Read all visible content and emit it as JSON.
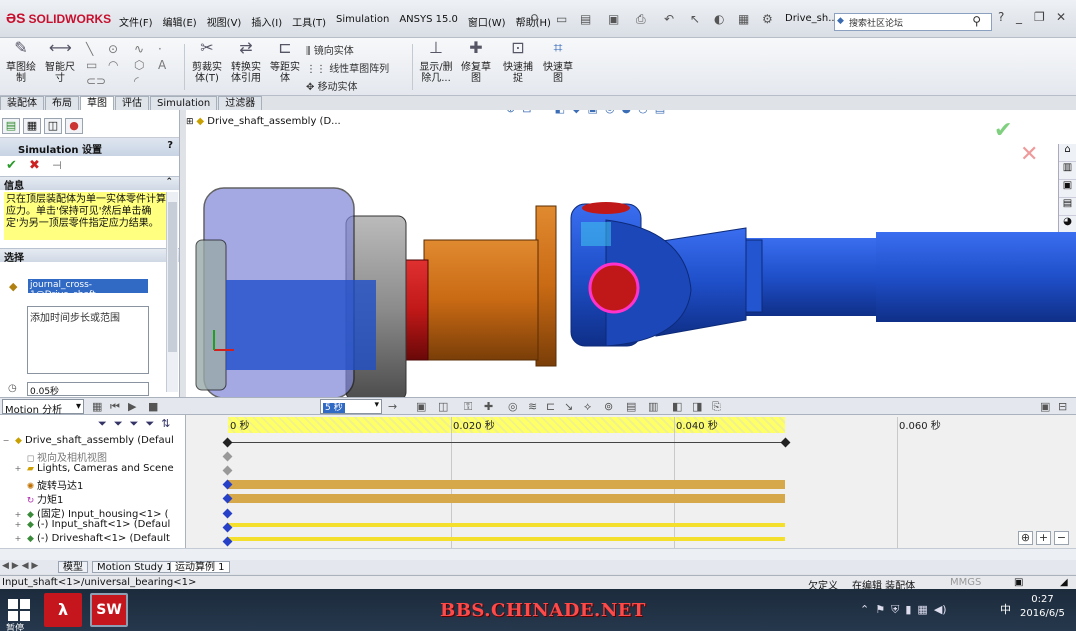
{
  "app": {
    "logo_text": "SOLIDWORKS",
    "document_title": "Drive_sh...",
    "search_placeholder": "搜索社区论坛"
  },
  "menu": [
    "文件(F)",
    "编辑(E)",
    "视图(V)",
    "插入(I)",
    "工具(T)",
    "Simulation",
    "ANSYS 15.0",
    "窗口(W)",
    "帮助(H)"
  ],
  "ribbon": {
    "sketch": "草图绘\n制",
    "smart_dim": "智能尺\n寸",
    "trim": "剪裁实\n体(T)",
    "convert": "转换实\n体引用",
    "offset": "等距实\n体",
    "mirror": "镜向实体",
    "linear_pattern": "线性草图阵列",
    "move": "移动实体",
    "show_delete": "显示/删\n除几...",
    "repair": "修复草\n图",
    "quick_snap": "快速捕\n捉",
    "quick_sketch": "快速草\n图"
  },
  "tabs": [
    "装配体",
    "布局",
    "草图",
    "评估",
    "Simulation",
    "过滤器"
  ],
  "active_tab": "草图",
  "property_manager": {
    "title": "Simulation 设置",
    "info_header": "信息",
    "info_text": "只在顶层装配体为单一实体零件计算应力。单击'保持可见'然后单击确定'为另一顶层零件指定应力结果。",
    "selection_header": "选择",
    "selected_entity": "journal_cross-1@Drive_shaft",
    "timestep_placeholder": "添加时间步长或范围",
    "time_value": "0.05秒"
  },
  "viewport": {
    "tree_root": "Drive_shaft_assembly  (D..."
  },
  "motion": {
    "study_type": "Motion 分析",
    "playback_speed": "5 秒",
    "ruler_labels": [
      "0 秒",
      "0.020 秒",
      "0.040 秒",
      "0.060 秒"
    ],
    "tree": [
      {
        "label": "Drive_shaft_assembly  (Defaul",
        "icon": "assembly-icon",
        "expander": "−"
      },
      {
        "label": "视向及相机视图",
        "icon": "camera-icon",
        "expander": ""
      },
      {
        "label": "Lights, Cameras and Scene",
        "icon": "light-icon",
        "expander": "+"
      },
      {
        "label": "旋转马达1",
        "icon": "motor-icon",
        "expander": ""
      },
      {
        "label": "力矩1",
        "icon": "torque-icon",
        "expander": ""
      },
      {
        "label": "(固定) Input_housing<1> (",
        "icon": "part-icon",
        "expander": "+"
      },
      {
        "label": "(-) Input_shaft<1> (Defaul",
        "icon": "part-icon",
        "expander": "+"
      },
      {
        "label": "(-) Driveshaft<1> (Default",
        "icon": "part-icon",
        "expander": "+"
      }
    ]
  },
  "study_tabs": [
    "模型",
    "Motion Study 1",
    "运动算例 1"
  ],
  "status": {
    "path": "Input_shaft<1>/universal_bearing<1>",
    "definition": "欠定义",
    "editing": "在编辑 装配体",
    "units": "MMGS"
  },
  "taskbar": {
    "watermark": "BBS.CHINADE.NET",
    "time": "0:27",
    "date": "2016/6/5",
    "ime": "中",
    "bottom_tip": "暂停"
  },
  "colors": {
    "shaft_blue": "#1f4fc9",
    "orange": "#c96a14",
    "red": "#c01818",
    "timeline_yellow": "#ffff66",
    "bar_brown": "#d6a84a"
  }
}
